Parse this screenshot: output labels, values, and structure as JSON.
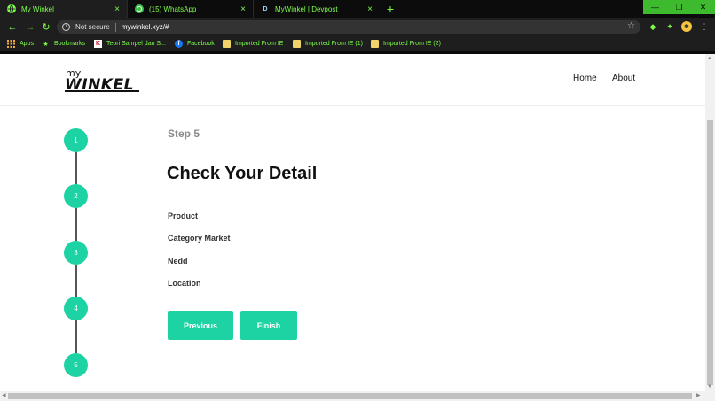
{
  "browser": {
    "tabs": [
      {
        "title": "My Winkel",
        "icon": "globe-icon",
        "close": "×"
      },
      {
        "title": "(15) WhatsApp",
        "icon": "whatsapp-icon",
        "close": "×"
      },
      {
        "title": "MyWinkel | Devpost",
        "icon": "devpost-icon",
        "icon_text": "D",
        "close": "×"
      }
    ],
    "new_tab": "+",
    "window_controls": {
      "minimize": "—",
      "maximize": "❐",
      "close": "✕"
    },
    "security_text": "Not secure",
    "url": "mywinkel.xyz/#",
    "bookmarks": [
      {
        "label": "Apps"
      },
      {
        "label": "Bookmarks"
      },
      {
        "label": "Teori Sampel dan S..."
      },
      {
        "label": "Facebook"
      },
      {
        "label": "Imported From IE"
      },
      {
        "label": "Imported From IE (1)"
      },
      {
        "label": "Imported From IE (2)"
      }
    ]
  },
  "site": {
    "logo_top": "my",
    "logo_main": "WINKEL",
    "nav": [
      {
        "label": "Home"
      },
      {
        "label": "About"
      }
    ]
  },
  "wizard": {
    "steps": [
      "1",
      "2",
      "3",
      "4",
      "5"
    ],
    "step_label": "Step 5",
    "title": "Check Your Detail",
    "fields": [
      "Product",
      "Category Market",
      "Nedd",
      "Location"
    ],
    "buttons": {
      "previous": "Previous",
      "finish": "Finish"
    }
  },
  "colors": {
    "accent": "#1dd3a3",
    "browser_accent": "#7dff4a",
    "browser_bg": "#1e1e1e"
  }
}
